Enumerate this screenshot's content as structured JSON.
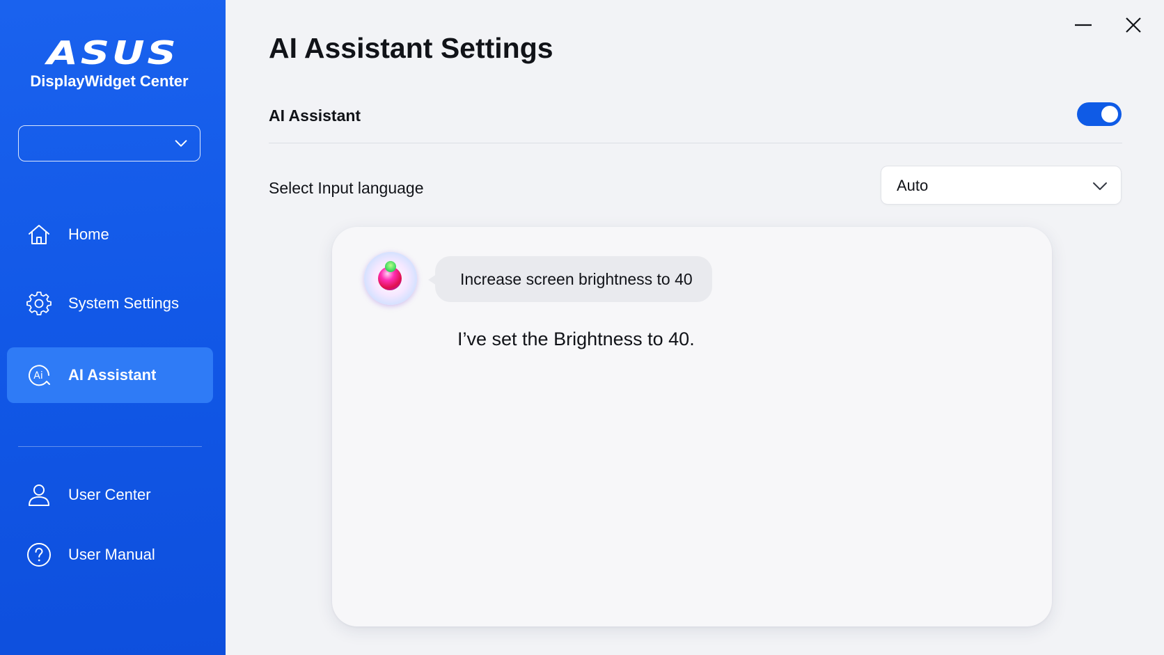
{
  "brand": {
    "logo_text": "ASUS",
    "app_name": "DisplayWidget Center"
  },
  "device_selector": {
    "value": "",
    "icon": "chevron-down-icon"
  },
  "sidebar": {
    "items": [
      {
        "label": "Home",
        "icon": "home-icon",
        "active": false
      },
      {
        "label": "System Settings",
        "icon": "gear-icon",
        "active": false
      },
      {
        "label": "AI Assistant",
        "icon": "ai-icon",
        "active": true
      },
      {
        "label": "User Center",
        "icon": "user-icon",
        "active": false
      },
      {
        "label": "User Manual",
        "icon": "help-icon",
        "active": false
      }
    ]
  },
  "window_controls": {
    "minimize_icon": "minimize-icon",
    "close_icon": "close-icon"
  },
  "main": {
    "title": "AI Assistant Settings",
    "ai_assistant": {
      "label": "AI Assistant",
      "enabled": true
    },
    "input_language": {
      "label": "Select Input language",
      "value": "Auto"
    },
    "chat": {
      "user_message": "Increase screen brightness to 40",
      "assistant_reply": "I’ve set the Brightness to 40."
    }
  },
  "colors": {
    "sidebar_blue": "#1157e6",
    "active_item": "#2f7bf6",
    "toggle_on": "#0f5be6",
    "background": "#f2f3f6"
  }
}
